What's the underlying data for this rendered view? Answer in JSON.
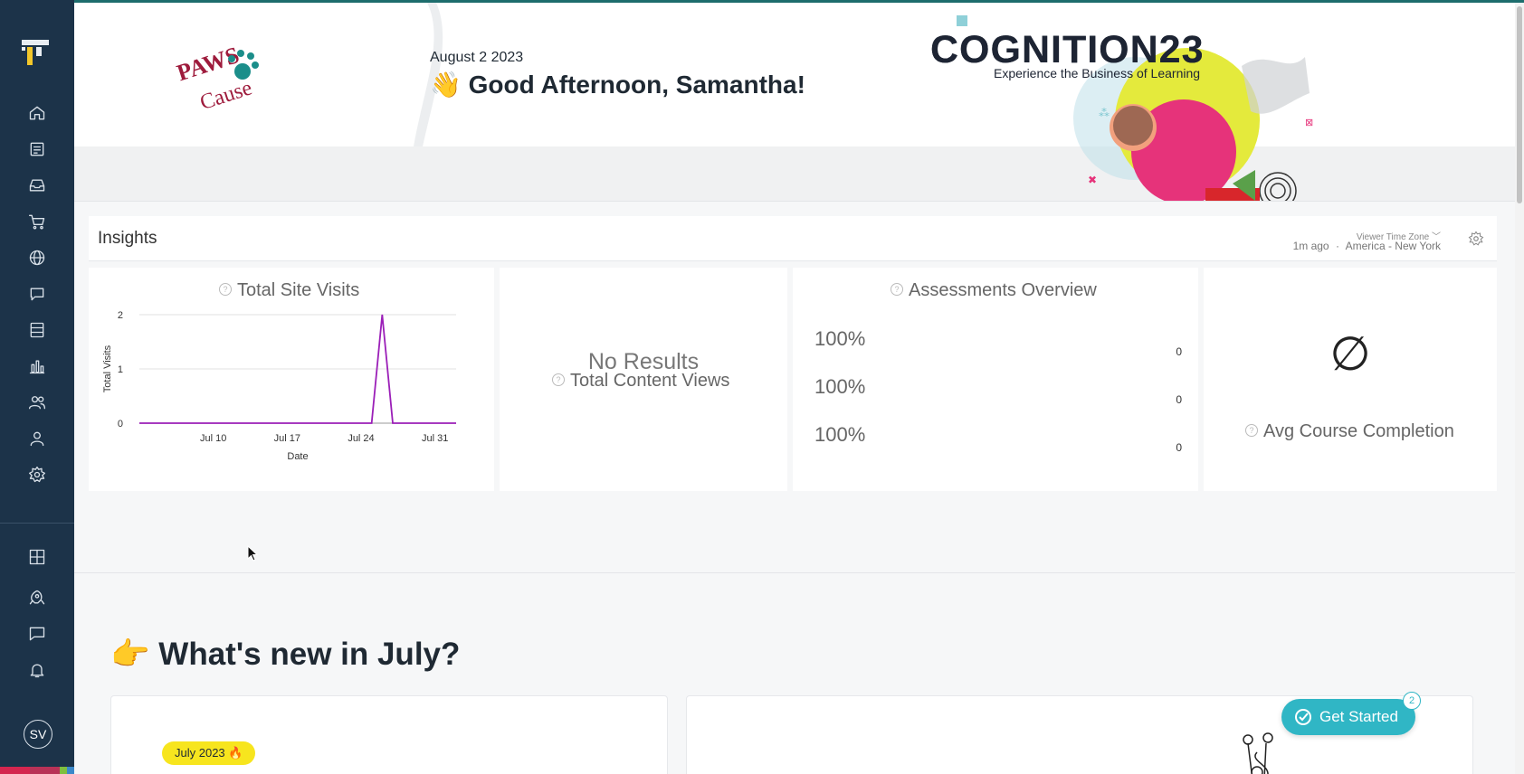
{
  "banner": {
    "date": "August 2 2023",
    "greeting": "👋 Good Afternoon, Samantha!",
    "event_title": "COGNITION23",
    "event_subtitle": "Experience the Business of Learning",
    "brand_logo_text": "PAWS Cause"
  },
  "insights": {
    "title": "Insights",
    "timezone_label": "Viewer Time Zone",
    "updated": "1m ago",
    "separator": "·",
    "timezone": "America - New York"
  },
  "site_visits": {
    "title": "Total Site Visits",
    "help": "?"
  },
  "content_views": {
    "no_results": "No Results",
    "title": "Total Content Views",
    "help": "?"
  },
  "assessments": {
    "title": "Assessments Overview",
    "help": "?",
    "rows": [
      {
        "percent": "100%",
        "count": "0"
      },
      {
        "percent": "100%",
        "count": "0"
      },
      {
        "percent": "100%",
        "count": "0"
      }
    ]
  },
  "completion": {
    "symbol": "∅",
    "title": "Avg Course Completion",
    "help": "?"
  },
  "whats_new": {
    "title": "👉 What's new in July?",
    "tag": "July 2023 🔥"
  },
  "get_started": {
    "label": "Get Started",
    "badge": "2"
  },
  "user": {
    "initials": "SV"
  },
  "sidebar": {
    "icons": [
      "home-icon",
      "courses-icon",
      "library-icon",
      "cart-icon",
      "globe-icon",
      "chat-icon",
      "catalog-icon",
      "analytics-icon",
      "groups-icon",
      "user-icon",
      "settings-icon",
      "apps-icon",
      "rocket-icon",
      "messages-icon",
      "bell-icon"
    ]
  },
  "colors": {
    "sidebar": "#1c3349",
    "accent": "#30b6c5",
    "chart_line": "#9b1fb8",
    "cognition_pink": "#e6337a",
    "tag_yellow": "#f7e51e"
  },
  "chart_data": {
    "type": "line",
    "title": "Total Site Visits",
    "xlabel": "Date",
    "ylabel": "Total Visits",
    "x_ticks": [
      "Jul 10",
      "Jul 17",
      "Jul 24",
      "Jul 31"
    ],
    "y_ticks": [
      "0",
      "1",
      "2"
    ],
    "ylim": [
      0,
      2
    ],
    "grid": true,
    "series": [
      {
        "x": [
          "Jul 3",
          "Jul 4",
          "Jul 5",
          "Jul 6",
          "Jul 7",
          "Jul 8",
          "Jul 9",
          "Jul 10",
          "Jul 11",
          "Jul 12",
          "Jul 13",
          "Jul 14",
          "Jul 15",
          "Jul 16",
          "Jul 17",
          "Jul 18",
          "Jul 19",
          "Jul 20",
          "Jul 21",
          "Jul 22",
          "Jul 23",
          "Jul 24",
          "Jul 25",
          "Jul 26",
          "Jul 27",
          "Jul 28",
          "Jul 29",
          "Jul 30",
          "Jul 31",
          "Aug 1",
          "Aug 2"
        ],
        "values": [
          0,
          0,
          0,
          0,
          0,
          0,
          0,
          0,
          0,
          0,
          0,
          0,
          0,
          0,
          0,
          0,
          0,
          0,
          0,
          0,
          0,
          0,
          0,
          2,
          0,
          0,
          0,
          0,
          0,
          0,
          0
        ]
      }
    ]
  }
}
